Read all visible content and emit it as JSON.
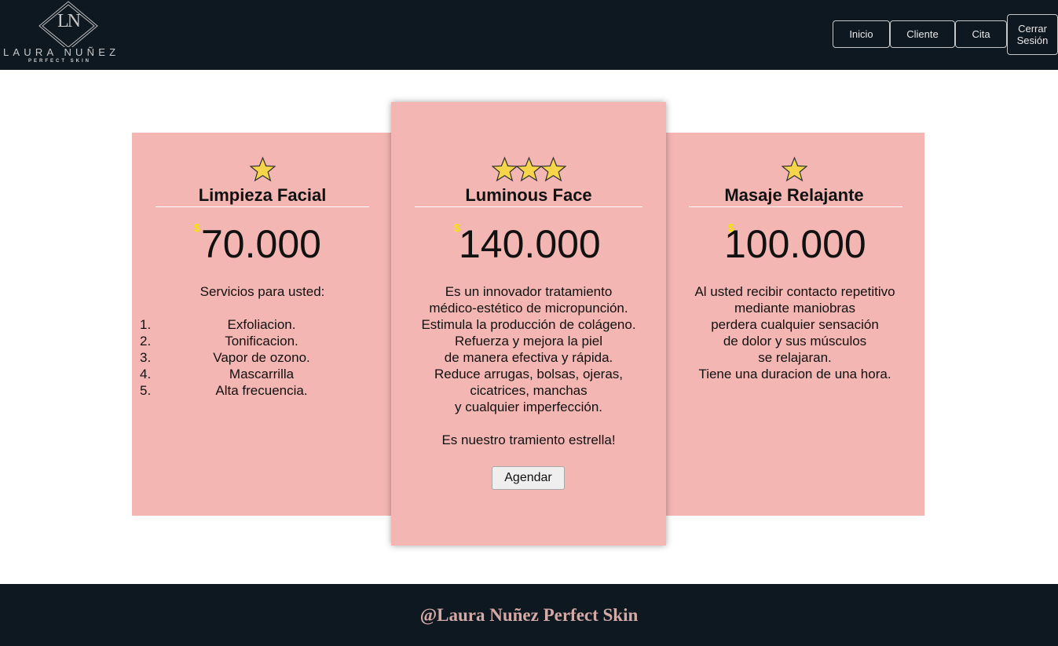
{
  "header": {
    "logo": {
      "monogram": "LN",
      "name": "LAURA NUÑEZ",
      "tagline": "PERFECT   SKIN"
    },
    "nav": [
      {
        "label": "Inicio"
      },
      {
        "label": "Cliente"
      },
      {
        "label": "Cita"
      },
      {
        "label_line1": "Cerrar",
        "label_line2": "Sesión"
      }
    ]
  },
  "cards": [
    {
      "stars": 1,
      "title": "Limpieza Facial",
      "currency": "$",
      "price": "70.000",
      "intro": "Servicios para usted:",
      "list": [
        {
          "num": "1.",
          "text": "Exfoliacion."
        },
        {
          "num": "2.",
          "text": "Tonificacion."
        },
        {
          "num": "3.",
          "text": "Vapor de ozono."
        },
        {
          "num": "4.",
          "text": "Mascarrilla"
        },
        {
          "num": "5.",
          "text": "Alta frecuencia."
        }
      ]
    },
    {
      "stars": 3,
      "title": "Luminous Face",
      "currency": "$",
      "price": "140.000",
      "lines": [
        "Es un innovador tratamiento",
        "médico-estético de micropunción.",
        "Estimula la producción de colágeno.",
        "Refuerza y mejora la piel",
        "de manera efectiva y rápida.",
        "Reduce arrugas, bolsas, ojeras,",
        "cicatrices, manchas",
        "y cualquier imperfección."
      ],
      "highlight": "Es nuestro tramiento estrella!",
      "button": "Agendar"
    },
    {
      "stars": 1,
      "title": "Masaje Relajante",
      "currency": "$",
      "price": "100.000",
      "lines": [
        "Al usted recibir contacto repetitivo",
        "mediante maniobras",
        "perdera cualquier sensación",
        "de dolor y sus músculos",
        "se relajaran.",
        "Tiene una duracion de una hora."
      ]
    }
  ],
  "colors": {
    "header_bg": "#0e1820",
    "card_bg": "#f4b6b3",
    "star": "#f7d54a",
    "currency": "#f5e400",
    "footer_text": "#d4aaa6"
  },
  "footer": {
    "text": "@Laura Nuñez Perfect Skin"
  }
}
